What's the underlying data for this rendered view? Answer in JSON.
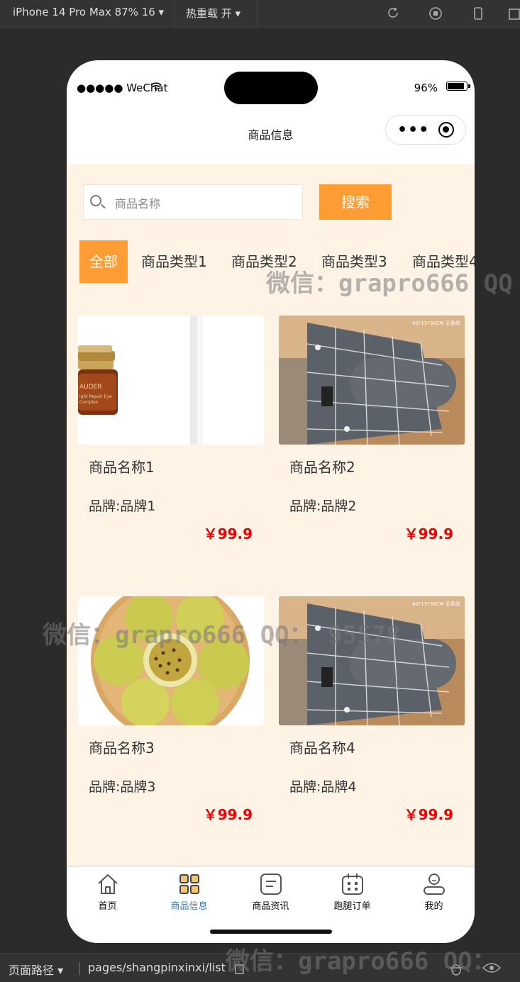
{
  "ide": {
    "device": "iPhone 14 Pro Max 87% 16 ▾",
    "hot_reload": "热重载 开 ▾",
    "bottom_label": "页面路径 ▾",
    "bottom_path": "pages/shangpinxinxi/list"
  },
  "status_bar": {
    "carrier": "●●●●● WeChat",
    "battery": "96%",
    "battery_level": 0.96
  },
  "navbar": {
    "title": "商品信息"
  },
  "search": {
    "placeholder": "商品名称",
    "button": "搜索"
  },
  "tabs": [
    {
      "label": "全部",
      "active": true
    },
    {
      "label": "商品类型1",
      "active": false
    },
    {
      "label": "商品类型2",
      "active": false
    },
    {
      "label": "商品类型3",
      "active": false
    },
    {
      "label": "商品类型4",
      "active": false
    }
  ],
  "products": [
    {
      "name": "商品名称1",
      "brand": "品牌:品牌1",
      "price": "￥99.9",
      "image": "cosmetics-jar-image"
    },
    {
      "name": "商品名称2",
      "brand": "品牌:品牌2",
      "price": "￥99.9",
      "image": "plaid-cushion-image"
    },
    {
      "name": "商品名称3",
      "brand": "品牌:品牌3",
      "price": "￥99.9",
      "image": "passion-fruit-image"
    },
    {
      "name": "商品名称4",
      "brand": "品牌:品牌4",
      "price": "￥99.9",
      "image": "plaid-cushion-image"
    }
  ],
  "tabbar": [
    {
      "label": "首页",
      "icon": "home-icon",
      "active": false
    },
    {
      "label": "商品信息",
      "icon": "grid-icon",
      "active": true
    },
    {
      "label": "商品资讯",
      "icon": "document-icon",
      "active": false
    },
    {
      "label": "跑腿订单",
      "icon": "calendar-icon",
      "active": false
    },
    {
      "label": "我的",
      "icon": "user-icon",
      "active": false
    }
  ],
  "watermarks": [
    "微信：grapro666 QQ",
    "微信：grapro666 QQ：      95578",
    "微信：grapro666 QQ："
  ],
  "colors": {
    "accent": "#ff9c33",
    "price": "#ee0000",
    "content_bg": "#fff3e6",
    "tab_active": "#3b7fb5"
  }
}
